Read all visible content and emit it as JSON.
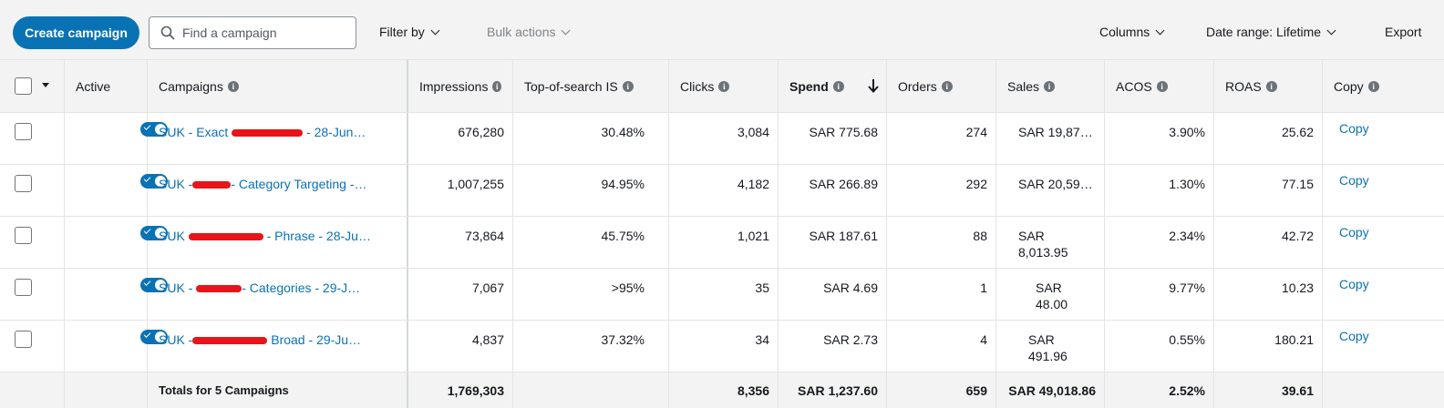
{
  "toolbar": {
    "create_label": "Create campaign",
    "search_placeholder": "Find a campaign",
    "filter_label": "Filter by",
    "bulk_label": "Bulk actions",
    "columns_label": "Columns",
    "date_range_label": "Date range: Lifetime",
    "export_label": "Export"
  },
  "table": {
    "headers": {
      "active": "Active",
      "campaigns": "Campaigns",
      "impressions": "Impressions",
      "top_of_search": "Top-of-search IS",
      "clicks": "Clicks",
      "spend": "Spend",
      "orders": "Orders",
      "sales": "Sales",
      "acos": "ACOS",
      "roas": "ROAS",
      "copy": "Copy"
    },
    "sort": {
      "column": "Spend",
      "direction": "descending"
    },
    "rows": [
      {
        "name_pre": "SUK - Exact ",
        "name_post": " - 28-Jun…",
        "active": true,
        "impressions": "676,280",
        "top_of_search": "30.48%",
        "clicks": "3,084",
        "spend": "SAR 775.68",
        "orders": "274",
        "sales": "SAR 19,87…",
        "acos": "3.90%",
        "roas": "25.62",
        "copy": "Copy"
      },
      {
        "name_pre": "SUK -",
        "name_post": "- Category Targeting -…",
        "active": true,
        "impressions": "1,007,255",
        "top_of_search": "94.95%",
        "clicks": "4,182",
        "spend": "SAR 266.89",
        "orders": "292",
        "sales": "SAR 20,59…",
        "acos": "1.30%",
        "roas": "77.15",
        "copy": "Copy"
      },
      {
        "name_pre": "SUK ",
        "name_post": " - Phrase - 28-Ju…",
        "active": true,
        "impressions": "73,864",
        "top_of_search": "45.75%",
        "clicks": "1,021",
        "spend": "SAR 187.61",
        "orders": "88",
        "sales": "SAR 8,013.95",
        "acos": "2.34%",
        "roas": "42.72",
        "copy": "Copy"
      },
      {
        "name_pre": "SUK - ",
        "name_post": "- Categories - 29-J…",
        "active": true,
        "impressions": "7,067",
        "top_of_search": ">95%",
        "clicks": "35",
        "spend": "SAR 4.69",
        "orders": "1",
        "sales": "SAR 48.00",
        "acos": "9.77%",
        "roas": "10.23",
        "copy": "Copy"
      },
      {
        "name_pre": "SUK -",
        "name_post": " Broad - 29-Ju…",
        "active": true,
        "impressions": "4,837",
        "top_of_search": "37.32%",
        "clicks": "34",
        "spend": "SAR 2.73",
        "orders": "4",
        "sales": "SAR 491.96",
        "acos": "0.55%",
        "roas": "180.21",
        "copy": "Copy"
      }
    ],
    "totals": {
      "label": "Totals for 5 Campaigns",
      "impressions": "1,769,303",
      "clicks": "8,356",
      "spend": "SAR 1,237.60",
      "orders": "659",
      "sales": "SAR 49,018.86",
      "acos": "2.52%",
      "roas": "39.61"
    }
  },
  "colors": {
    "accent": "#0972b5",
    "redaction": "#e8141a",
    "header_bg": "#f3f3f3"
  }
}
